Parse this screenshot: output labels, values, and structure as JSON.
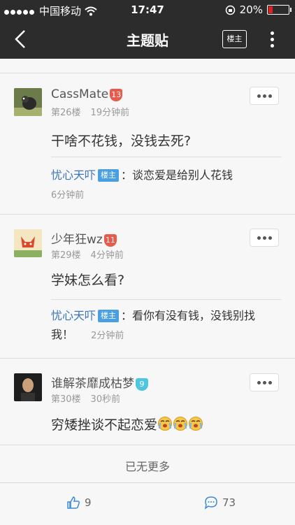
{
  "status": {
    "carrier": "中国移动",
    "time": "17:47",
    "battery": "20%"
  },
  "nav": {
    "title": "主题贴",
    "louzhu": "楼主"
  },
  "posts": [
    {
      "user": "CassMate",
      "level": "13",
      "level_color": "#e85b4a",
      "floor": "第26楼",
      "time": "19分钟前",
      "text": "干啥不花钱，没钱去死?",
      "reply": {
        "user": "忧心天吓",
        "badge": "楼主",
        "text": "：谈恋爱是给别人花钱",
        "time": "6分钟前"
      }
    },
    {
      "user": "少年狂wz",
      "level": "11",
      "level_color": "#e85b4a",
      "floor": "第29楼",
      "time": "4分钟前",
      "text": "学妹怎么看?",
      "reply": {
        "user": "忧心天吓",
        "badge": "楼主",
        "text": "：看你有没有钱，没钱别找我！",
        "time": "2分钟前"
      }
    },
    {
      "user": "谁解茶靡成枯梦",
      "level": "9",
      "level_color": "#4fc6e0",
      "floor": "第30楼",
      "time": "30秒前",
      "text": "穷矮挫谈不起恋爱"
    }
  ],
  "footer": {
    "no_more": "已无更多"
  },
  "bottom": {
    "likes": "9",
    "comments": "73"
  }
}
